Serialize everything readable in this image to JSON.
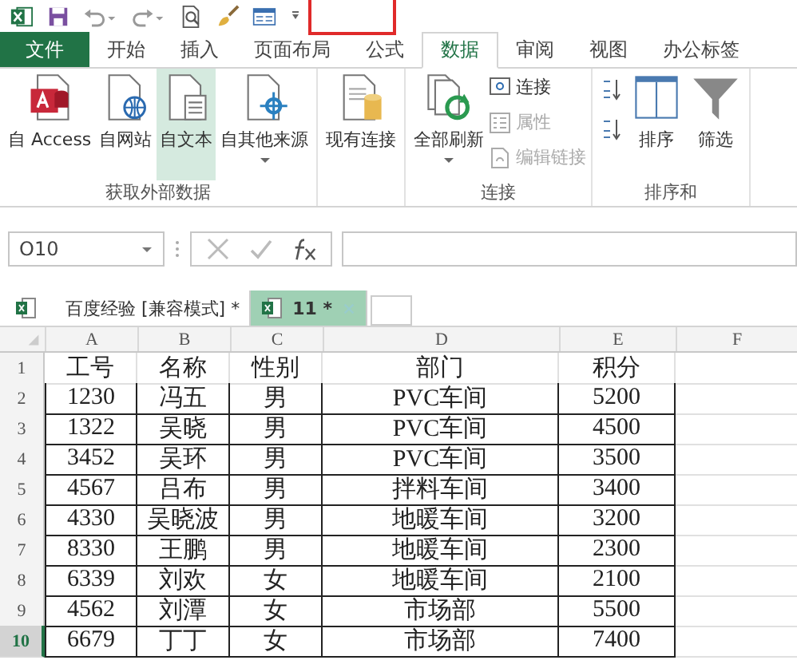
{
  "annotations": [
    {
      "kind": "rectangle"
    }
  ],
  "ribbon_tabs": [
    {
      "label": "文件",
      "selected": false,
      "kind": "file"
    },
    {
      "label": "开始",
      "selected": false,
      "kind": "tab"
    },
    {
      "label": "插入",
      "selected": false,
      "kind": "tab"
    },
    {
      "label": "页面布局",
      "selected": false,
      "kind": "tab"
    },
    {
      "label": "公式",
      "selected": false,
      "kind": "tab"
    },
    {
      "label": "数据",
      "selected": true,
      "kind": "tab"
    },
    {
      "label": "审阅",
      "selected": false,
      "kind": "tab"
    },
    {
      "label": "视图",
      "selected": false,
      "kind": "tab"
    },
    {
      "label": "办公标签",
      "selected": false,
      "kind": "tab"
    }
  ],
  "ribbon_groups": [
    {
      "label": "获取外部数据",
      "items": [
        {
          "kind": "large",
          "label": "自 Access",
          "selected": false,
          "dropdown": false
        },
        {
          "kind": "large",
          "label": "自网站",
          "selected": false,
          "dropdown": false
        },
        {
          "kind": "large",
          "label": "自文本",
          "selected": true,
          "dropdown": false
        },
        {
          "kind": "large",
          "label": "自其他来源",
          "selected": false,
          "dropdown": true
        }
      ]
    },
    {
      "items": [
        {
          "kind": "large",
          "label": "现有连接",
          "selected": false,
          "dropdown": false
        }
      ]
    },
    {
      "label": "连接",
      "items": [
        {
          "kind": "large",
          "label": "全部刷新",
          "selected": false,
          "dropdown": true
        },
        {
          "kind": "stack",
          "items": [
            {
              "label": "连接",
              "disabled": false
            },
            {
              "label": "属性",
              "disabled": true
            },
            {
              "label": "编辑链接",
              "disabled": true
            }
          ]
        }
      ]
    },
    {
      "label": "排序和",
      "items": [
        {
          "kind": "stack",
          "items": [
            {
              "disabled": false
            },
            {
              "disabled": false
            }
          ]
        },
        {
          "kind": "large",
          "label": "排序",
          "selected": false,
          "dropdown": false
        },
        {
          "kind": "large",
          "label": "筛选",
          "selected": false,
          "dropdown": false
        }
      ]
    }
  ],
  "name_box": "O10",
  "workbook_tabs": [
    {
      "label": "百度经验  [兼容模式] *",
      "selected": false
    },
    {
      "label": "11 *",
      "selected": true
    }
  ],
  "columns": [
    "A",
    "B",
    "C",
    "D",
    "E",
    "F"
  ],
  "rows": [
    {
      "number": "1",
      "selected": false,
      "cells": [
        "工号",
        "名称",
        "性别",
        "部门",
        "积分"
      ]
    },
    {
      "number": "2",
      "selected": false,
      "cells": [
        "1230",
        "冯五",
        "男",
        "PVC车间",
        "5200"
      ]
    },
    {
      "number": "3",
      "selected": false,
      "cells": [
        "1322",
        "吴晓",
        "男",
        "PVC车间",
        "4500"
      ]
    },
    {
      "number": "4",
      "selected": false,
      "cells": [
        "3452",
        "吴环",
        "男",
        "PVC车间",
        "3500"
      ]
    },
    {
      "number": "5",
      "selected": false,
      "cells": [
        "4567",
        "吕布",
        "男",
        "拌料车间",
        "3400"
      ]
    },
    {
      "number": "6",
      "selected": false,
      "cells": [
        "4330",
        "吴晓波",
        "男",
        "地暖车间",
        "3200"
      ]
    },
    {
      "number": "7",
      "selected": false,
      "cells": [
        "8330",
        "王鹏",
        "男",
        "地暖车间",
        "2300"
      ]
    },
    {
      "number": "8",
      "selected": false,
      "cells": [
        "6339",
        "刘欢",
        "女",
        "地暖车间",
        "2100"
      ]
    },
    {
      "number": "9",
      "selected": false,
      "cells": [
        "4562",
        "刘潭",
        "女",
        "市场部",
        "5500"
      ]
    },
    {
      "number": "10",
      "selected": true,
      "cells": [
        "6679",
        "丁丁",
        "女",
        "市场部",
        "7400"
      ]
    }
  ]
}
